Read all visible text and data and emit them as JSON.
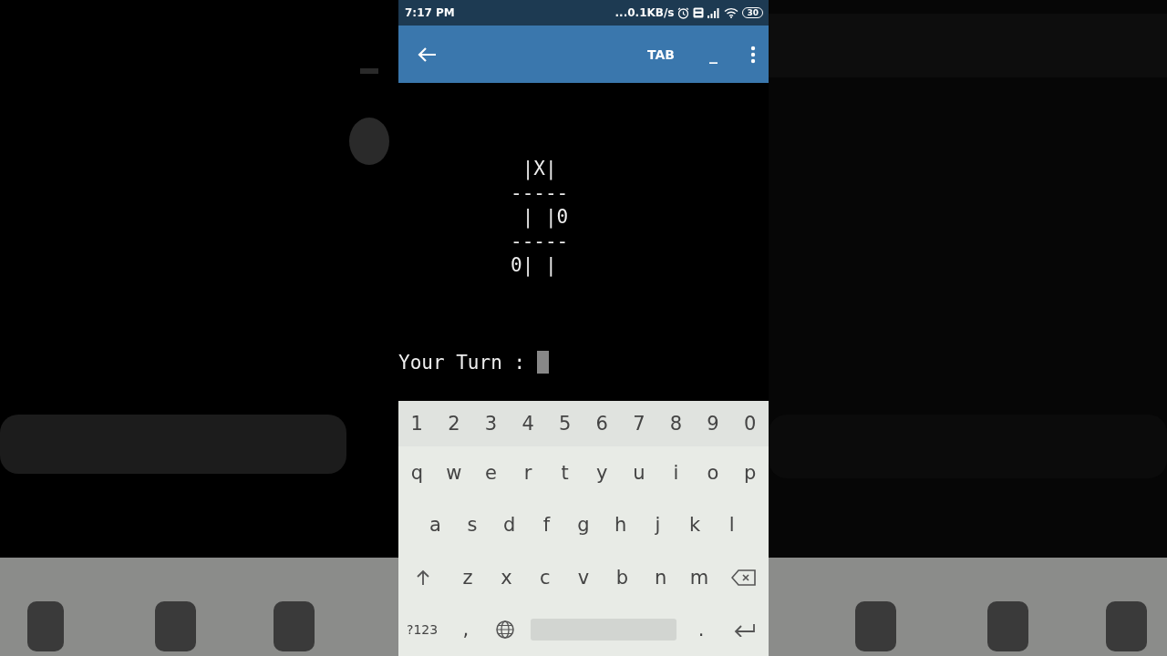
{
  "status_bar": {
    "time": "7:17 PM",
    "network_speed": "...0.1KB/s",
    "battery": "30"
  },
  "toolbar": {
    "title": "TAB",
    "minimize": "_"
  },
  "terminal": {
    "board": [
      " |X|",
      "-----",
      " | |0",
      "-----",
      "0| |"
    ],
    "prompt": "Your Turn : "
  },
  "keyboard": {
    "rows": [
      [
        {
          "kind": "char",
          "label": "1"
        },
        {
          "kind": "char",
          "label": "2"
        },
        {
          "kind": "char",
          "label": "3"
        },
        {
          "kind": "char",
          "label": "4"
        },
        {
          "kind": "char",
          "label": "5"
        },
        {
          "kind": "char",
          "label": "6"
        },
        {
          "kind": "char",
          "label": "7"
        },
        {
          "kind": "char",
          "label": "8"
        },
        {
          "kind": "char",
          "label": "9"
        },
        {
          "kind": "char",
          "label": "0"
        }
      ],
      [
        {
          "kind": "char",
          "label": "q"
        },
        {
          "kind": "char",
          "label": "w"
        },
        {
          "kind": "char",
          "label": "e"
        },
        {
          "kind": "char",
          "label": "r"
        },
        {
          "kind": "char",
          "label": "t"
        },
        {
          "kind": "char",
          "label": "y"
        },
        {
          "kind": "char",
          "label": "u"
        },
        {
          "kind": "char",
          "label": "i"
        },
        {
          "kind": "char",
          "label": "o"
        },
        {
          "kind": "char",
          "label": "p"
        }
      ],
      [
        {
          "kind": "char",
          "label": "a"
        },
        {
          "kind": "char",
          "label": "s"
        },
        {
          "kind": "char",
          "label": "d"
        },
        {
          "kind": "char",
          "label": "f"
        },
        {
          "kind": "char",
          "label": "g"
        },
        {
          "kind": "char",
          "label": "h"
        },
        {
          "kind": "char",
          "label": "j"
        },
        {
          "kind": "char",
          "label": "k"
        },
        {
          "kind": "char",
          "label": "l"
        }
      ],
      [
        {
          "kind": "shift"
        },
        {
          "kind": "char",
          "label": "z"
        },
        {
          "kind": "char",
          "label": "x"
        },
        {
          "kind": "char",
          "label": "c"
        },
        {
          "kind": "char",
          "label": "v"
        },
        {
          "kind": "char",
          "label": "b"
        },
        {
          "kind": "char",
          "label": "n"
        },
        {
          "kind": "char",
          "label": "m"
        },
        {
          "kind": "backspace"
        }
      ],
      [
        {
          "kind": "symbols",
          "label": "?123"
        },
        {
          "kind": "char",
          "label": ","
        },
        {
          "kind": "globe"
        },
        {
          "kind": "space"
        },
        {
          "kind": "char",
          "label": "."
        },
        {
          "kind": "enter"
        }
      ]
    ]
  }
}
